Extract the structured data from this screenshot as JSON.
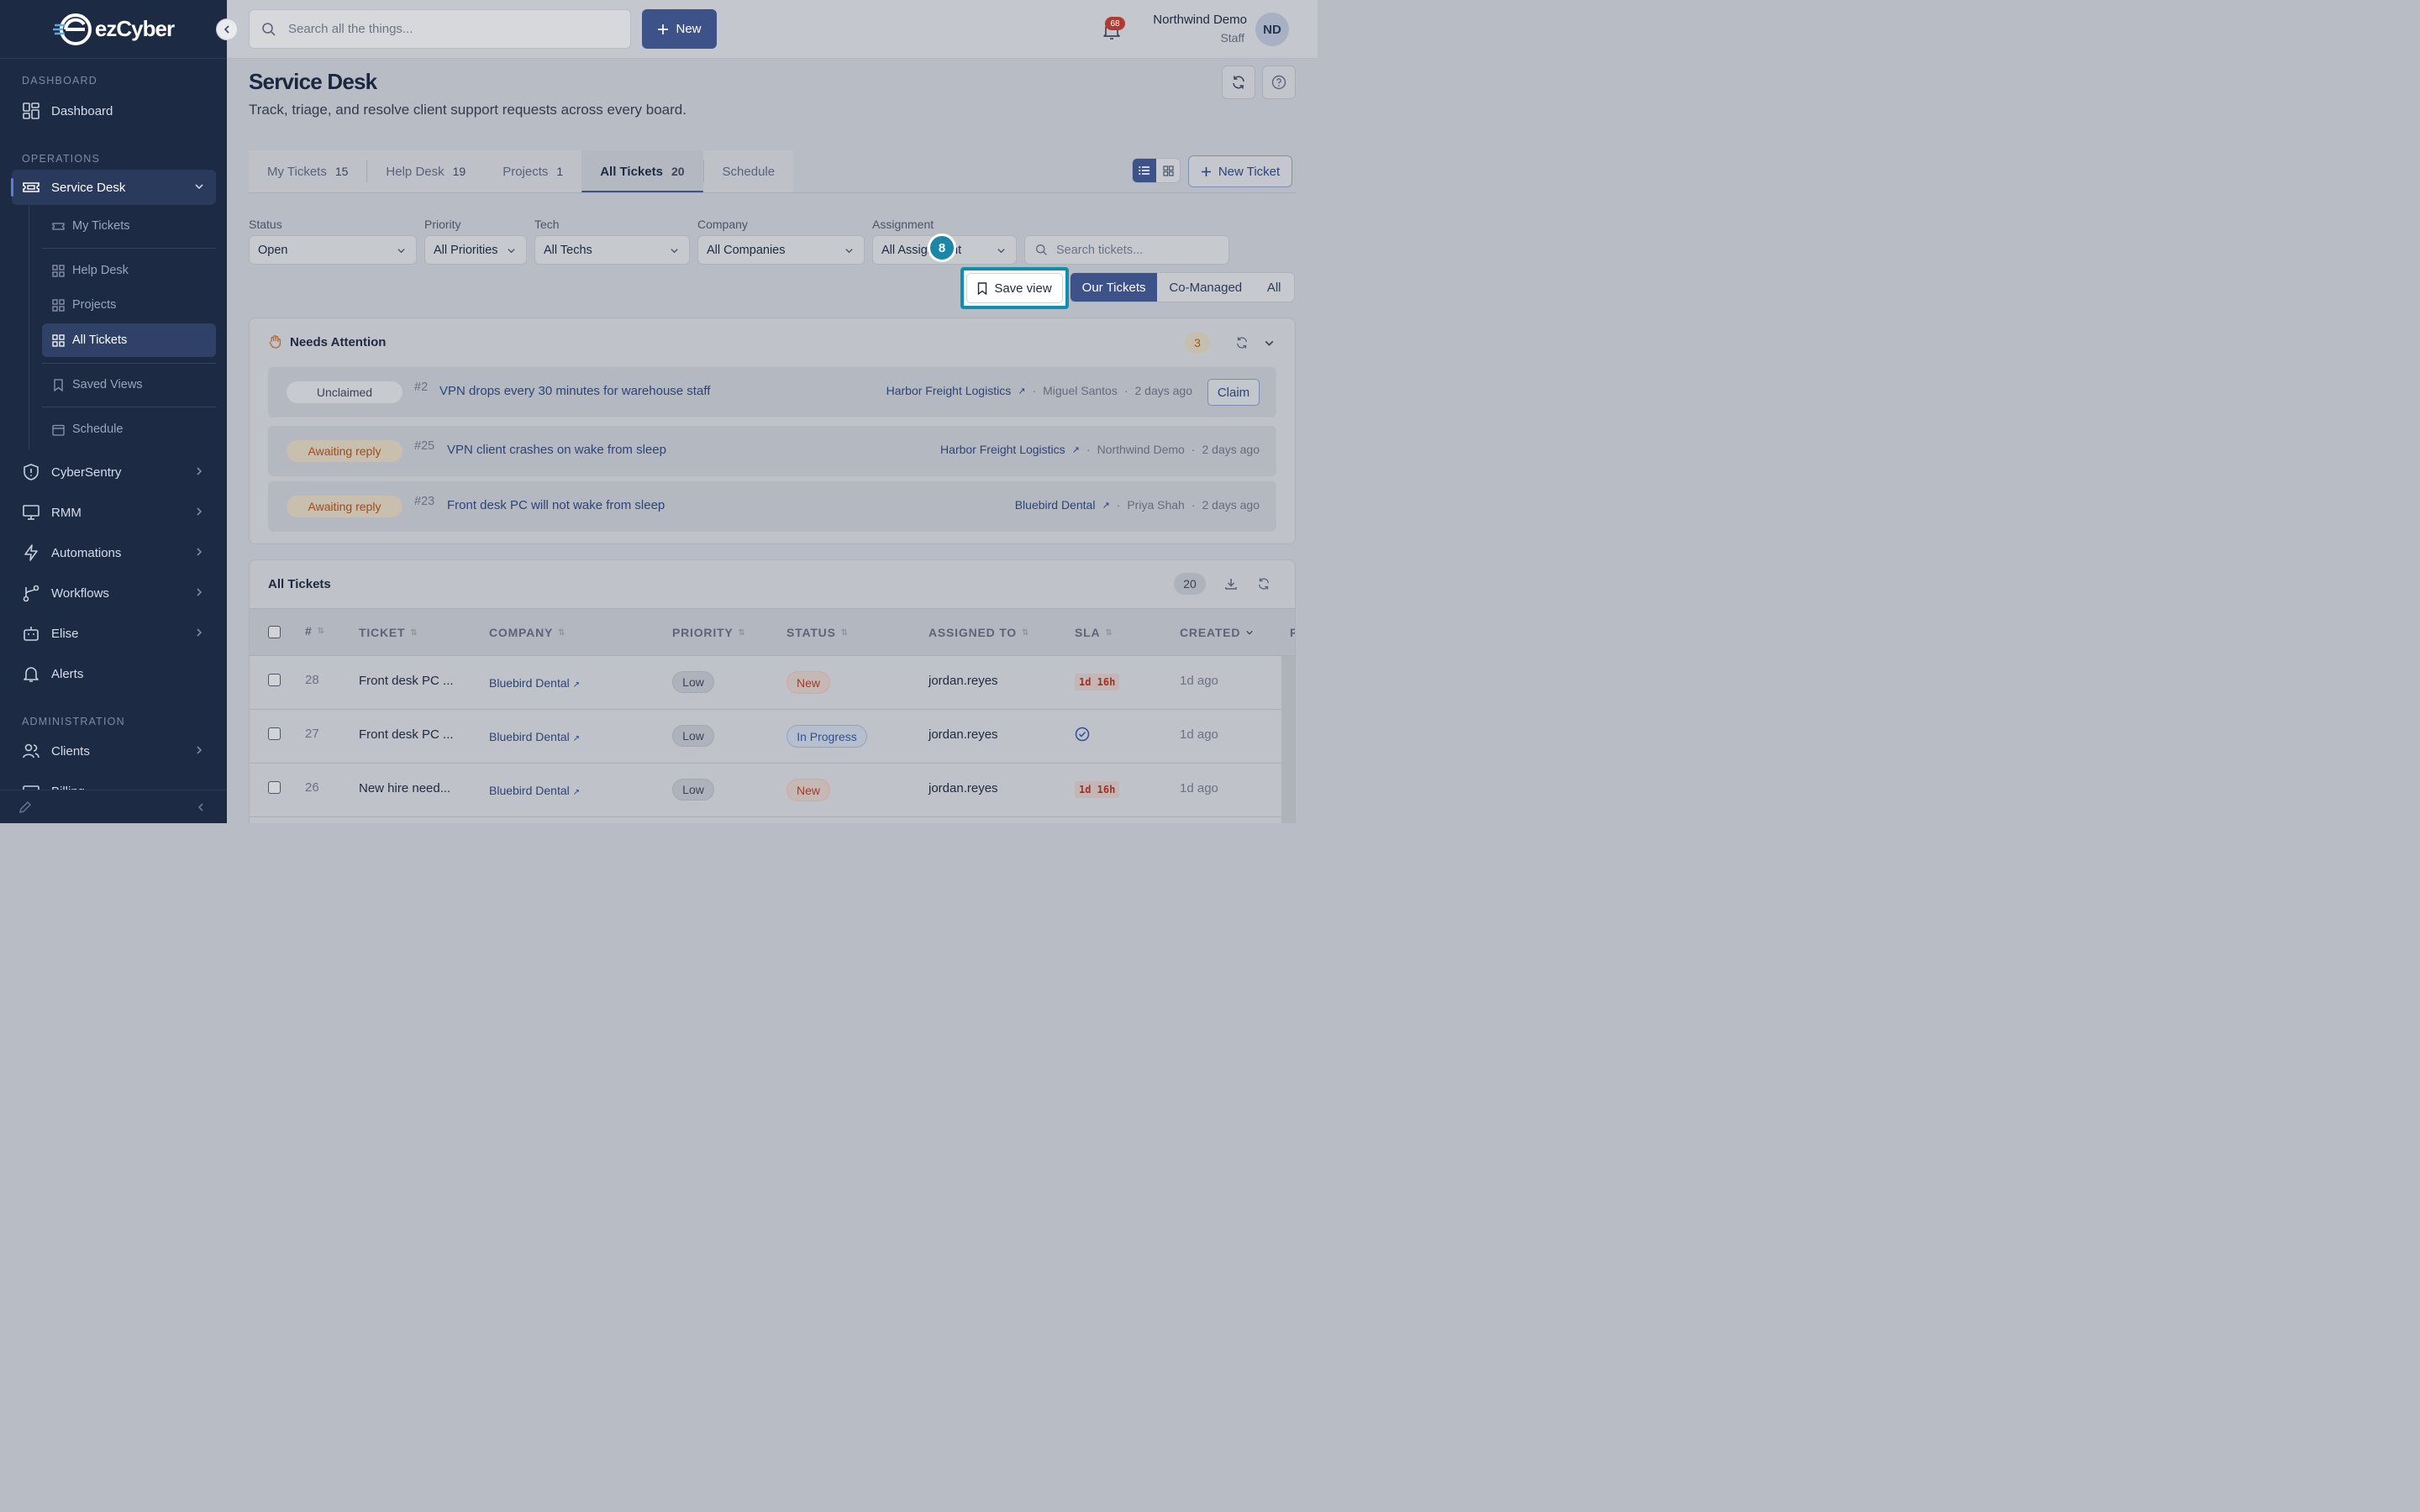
{
  "app": {
    "brand": "ezCyber"
  },
  "sidebar": {
    "sections": {
      "dashboard": "DASHBOARD",
      "operations": "OPERATIONS",
      "administration": "ADMINISTRATION"
    },
    "items": {
      "dashboard": "Dashboard",
      "service_desk": "Service Desk",
      "cybersentry": "CyberSentry",
      "rmm": "RMM",
      "automations": "Automations",
      "workflows": "Workflows",
      "elise": "Elise",
      "alerts": "Alerts",
      "clients": "Clients",
      "billing": "Billing"
    },
    "sub_items": {
      "my_tickets": "My Tickets",
      "help_desk": "Help Desk",
      "projects": "Projects",
      "all_tickets": "All Tickets",
      "saved_views": "Saved Views",
      "schedule": "Schedule"
    }
  },
  "topbar": {
    "search_placeholder": "Search all the things...",
    "new_label": "New",
    "notification_count": "68",
    "user_name": "Northwind Demo",
    "user_role": "Staff",
    "avatar_initials": "ND"
  },
  "page": {
    "title": "Service Desk",
    "subtitle": "Track, triage, and resolve client support requests across every board."
  },
  "tabs": [
    {
      "label": "My Tickets",
      "count": "15"
    },
    {
      "label": "Help Desk",
      "count": "19"
    },
    {
      "label": "Projects",
      "count": "1"
    },
    {
      "label": "All Tickets",
      "count": "20"
    },
    {
      "label": "Schedule",
      "count": ""
    }
  ],
  "new_ticket_label": "New Ticket",
  "filters": {
    "status": {
      "label": "Status",
      "value": "Open"
    },
    "priority": {
      "label": "Priority",
      "value": "All Priorities"
    },
    "tech": {
      "label": "Tech",
      "value": "All Techs"
    },
    "company": {
      "label": "Company",
      "value": "All Companies"
    },
    "assignment": {
      "label": "Assignment",
      "value": "All Assignment"
    },
    "search_placeholder": "Search tickets..."
  },
  "step_badge": "8",
  "save_view_label": "Save view",
  "scope": {
    "our": "Our Tickets",
    "co_managed": "Co-Managed",
    "all": "All"
  },
  "needs_attention": {
    "title": "Needs Attention",
    "count": "3",
    "rows": [
      {
        "tag": "Unclaimed",
        "num": "#2",
        "title": "VPN drops every 30 minutes for warehouse staff",
        "company": "Harbor Freight Logistics",
        "person": "Miguel Santos",
        "age": "2 days ago",
        "action": "Claim"
      },
      {
        "tag": "Awaiting reply",
        "num": "#25",
        "title": "VPN client crashes on wake from sleep",
        "company": "Harbor Freight Logistics",
        "person": "Northwind Demo",
        "age": "2 days ago"
      },
      {
        "tag": "Awaiting reply",
        "num": "#23",
        "title": "Front desk PC will not wake from sleep",
        "company": "Bluebird Dental",
        "person": "Priya Shah",
        "age": "2 days ago"
      }
    ]
  },
  "all_tickets": {
    "title": "All Tickets",
    "count": "20",
    "columns": {
      "num": "#",
      "ticket": "TICKET",
      "company": "COMPANY",
      "priority": "PRIORITY",
      "status": "STATUS",
      "assigned": "ASSIGNED TO",
      "sla": "SLA",
      "created": "CREATED",
      "more": "R"
    },
    "rows": [
      {
        "num": "28",
        "ticket": "Front desk PC ...",
        "company": "Bluebird Dental",
        "priority": "Low",
        "status": "New",
        "assigned": "jordan.reyes",
        "sla": "1d 16h",
        "created": "1d ago"
      },
      {
        "num": "27",
        "ticket": "Front desk PC ...",
        "company": "Bluebird Dental",
        "priority": "Low",
        "status": "In Progress",
        "assigned": "jordan.reyes",
        "sla": "",
        "created": "1d ago"
      },
      {
        "num": "26",
        "ticket": "New hire need...",
        "company": "Bluebird Dental",
        "priority": "Low",
        "status": "New",
        "assigned": "jordan.reyes",
        "sla": "1d 16h",
        "created": "1d ago"
      }
    ]
  },
  "colors": {
    "sidebar": "#1d2a44",
    "accent": "#3d5288",
    "highlight": "#0f8fae",
    "danger": "#a33a28"
  }
}
